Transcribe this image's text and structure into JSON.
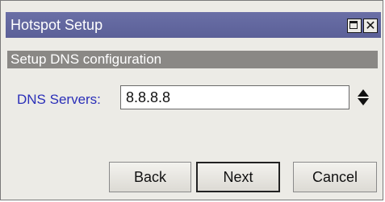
{
  "window": {
    "title": "Hotspot Setup",
    "controls": [
      "maximize-icon",
      "close-icon"
    ],
    "close_glyph": "✕"
  },
  "section": {
    "header": "Setup DNS configuration"
  },
  "form": {
    "dns_label": "DNS Servers:",
    "dns_value": "8.8.8.8"
  },
  "buttons": {
    "back": "Back",
    "next": "Next",
    "cancel": "Cancel"
  },
  "colors": {
    "titlebar": "#5b6098",
    "section_header": "#8a8885",
    "label": "#2b2fb8",
    "window_bg": "#ecebe6"
  }
}
